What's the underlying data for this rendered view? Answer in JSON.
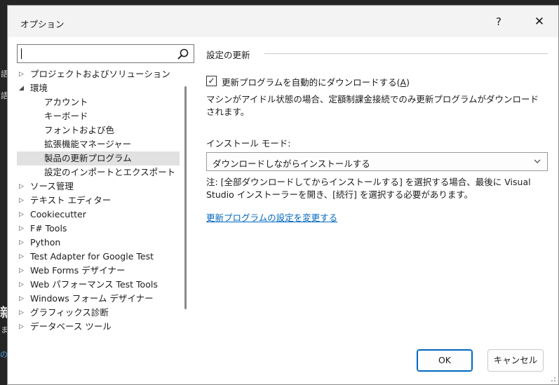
{
  "dialog": {
    "title": "オプション",
    "help_glyph": "?",
    "close_glyph": "✕"
  },
  "search": {
    "value": "",
    "placeholder": ""
  },
  "tree": [
    {
      "label": "プロジェクトおよびソリューション",
      "expander": "▷",
      "level": 0
    },
    {
      "label": "環境",
      "expander": "◢",
      "level": 0
    },
    {
      "label": "アカウント",
      "level": 1
    },
    {
      "label": "キーボード",
      "level": 1
    },
    {
      "label": "フォントおよび色",
      "level": 1
    },
    {
      "label": "拡張機能マネージャー",
      "level": 1
    },
    {
      "label": "製品の更新プログラム",
      "level": 1,
      "selected": true
    },
    {
      "label": "設定のインポートとエクスポート",
      "level": 1
    },
    {
      "label": "ソース管理",
      "expander": "▷",
      "level": 0
    },
    {
      "label": "テキスト エディター",
      "expander": "▷",
      "level": 0
    },
    {
      "label": "Cookiecutter",
      "expander": "▷",
      "level": 0
    },
    {
      "label": "F# Tools",
      "expander": "▷",
      "level": 0
    },
    {
      "label": "Python",
      "expander": "▷",
      "level": 0
    },
    {
      "label": "Test Adapter for Google Test",
      "expander": "▷",
      "level": 0
    },
    {
      "label": "Web Forms デザイナー",
      "expander": "▷",
      "level": 0
    },
    {
      "label": "Web パフォーマンス Test Tools",
      "expander": "▷",
      "level": 0
    },
    {
      "label": "Windows フォーム デザイナー",
      "expander": "▷",
      "level": 0
    },
    {
      "label": "グラフィックス診断",
      "expander": "▷",
      "level": 0
    },
    {
      "label": "データベース ツール",
      "expander": "▷",
      "level": 0
    }
  ],
  "panel": {
    "section_title": "設定の更新",
    "auto_download": {
      "checked": true,
      "check_glyph": "✓",
      "label_prefix": "更新プログラムを自動的にダウンロードする(",
      "access_key": "A",
      "label_suffix": ")"
    },
    "description": "マシンがアイドル状態の場合、定額制課金接続でのみ更新プログラムがダウンロードされます。",
    "install_mode_label": "インストール モード:",
    "install_mode_value": "ダウンロードしながらインストールする",
    "note": "注: [全部ダウンロードしてからインストールする] を選択する場合、最後に Visual Studio インストーラーを開き、[続行] を選択する必要があります。",
    "link": "更新プログラムの設定を変更する"
  },
  "buttons": {
    "ok": "OK",
    "cancel": "キャンセル"
  },
  "background": {
    "fragments": [
      "語",
      "語",
      "ま",
      "の更",
      "新"
    ]
  },
  "colors": {
    "accent": "#0067c0",
    "selection": "#e1e1e1",
    "titlebar": "#f3f3f3"
  }
}
